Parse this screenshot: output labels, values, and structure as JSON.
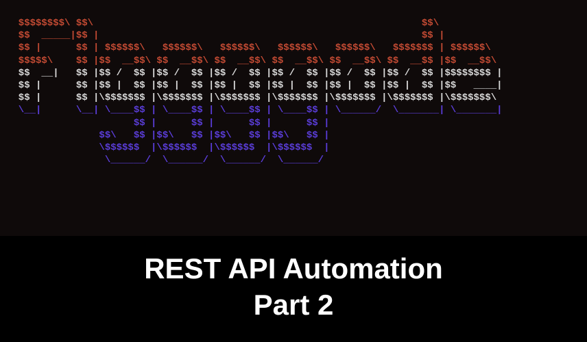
{
  "ascii": {
    "lines": [
      {
        "cls": "red",
        "text": "  $$$$$$$$\\ $$\\                                                         $$\\           "
      },
      {
        "cls": "red",
        "text": "  $$  _____|$$ |                                                        $$ |          "
      },
      {
        "cls": "red",
        "text": "  $$ |      $$ | $$$$$$\\   $$$$$$\\   $$$$$$\\   $$$$$$\\   $$$$$$\\   $$$$$$$ | $$$$$$\\  "
      },
      {
        "cls": "red",
        "text": "  $$$$$\\    $$ |$$  __$$\\ $$  __$$\\ $$  __$$\\ $$  __$$\\ $$  __$$\\ $$  __$$ |$$  __$$\\ "
      },
      {
        "cls": "white",
        "text": "  $$  __|   $$ |$$ /  $$ |$$ /  $$ |$$ /  $$ |$$ /  $$ |$$ /  $$ |$$ /  $$ |$$$$$$$$ |"
      },
      {
        "cls": "white",
        "text": "  $$ |      $$ |$$ |  $$ |$$ |  $$ |$$ |  $$ |$$ |  $$ |$$ |  $$ |$$ |  $$ |$$   ____|"
      },
      {
        "cls": "white",
        "text": "  $$ |      $$ |\\$$$$$$$ |\\$$$$$$$ |\\$$$$$$$ |\\$$$$$$$ |\\$$$$$$$ |\\$$$$$$$ |\\$$$$$$$\\ "
      },
      {
        "cls": "purple",
        "text": "  \\__|      \\__| \\____$$ | \\____$$ | \\____$$ | \\____$$ | \\______/  \\_______| \\_______|"
      },
      {
        "cls": "purple",
        "text": "                      $$ |      $$ |      $$ |      $$ |                              "
      },
      {
        "cls": "purple",
        "text": "                $$\\   $$ |$$\\   $$ |$$\\   $$ |$$\\   $$ |                              "
      },
      {
        "cls": "purple",
        "text": "                \\$$$$$$  |\\$$$$$$  |\\$$$$$$  |\\$$$$$$  |                              "
      },
      {
        "cls": "purple",
        "text": "                 \\______/  \\______/  \\______/  \\______/                               "
      }
    ]
  },
  "footer": {
    "title": "REST API Automation",
    "subtitle": "Part 2"
  }
}
